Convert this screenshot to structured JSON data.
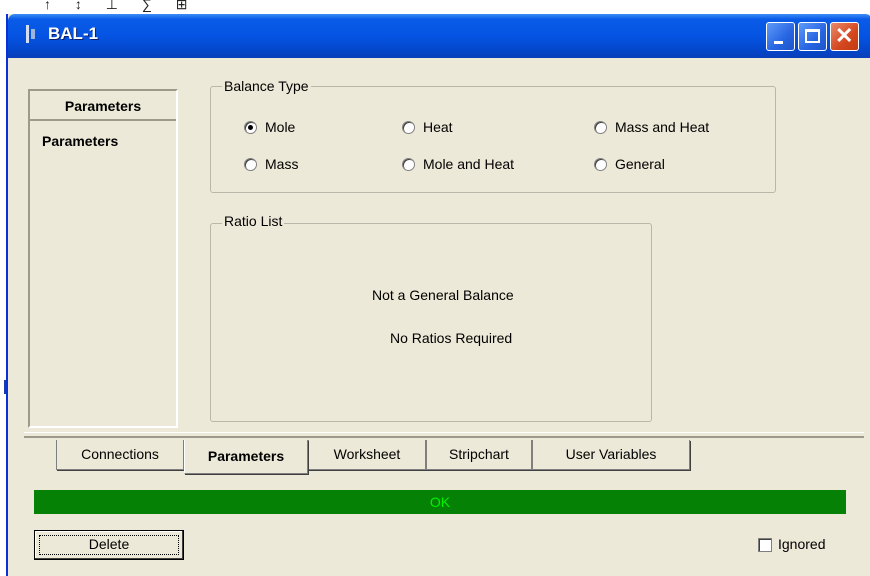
{
  "top_strip": {
    "glyphs": "↑ ↕ ⊥ ∑ ⊞"
  },
  "window": {
    "title": "BAL-1"
  },
  "nav": {
    "header": "Parameters",
    "items": [
      "Parameters"
    ]
  },
  "balance_type": {
    "legend": "Balance Type",
    "options": [
      "Mole",
      "Heat",
      "Mass and Heat",
      "Mass",
      "Mole and Heat",
      "General"
    ],
    "selected": "Mole"
  },
  "ratio_list": {
    "legend": "Ratio List",
    "line1": "Not a General Balance",
    "line2": "No Ratios Required"
  },
  "tabs": [
    "Connections",
    "Parameters",
    "Worksheet",
    "Stripchart",
    "User Variables"
  ],
  "active_tab": "Parameters",
  "status": {
    "text": "OK",
    "color": "#058205"
  },
  "buttons": {
    "delete": "Delete"
  },
  "ignored": {
    "label": "Ignored",
    "checked": false
  }
}
